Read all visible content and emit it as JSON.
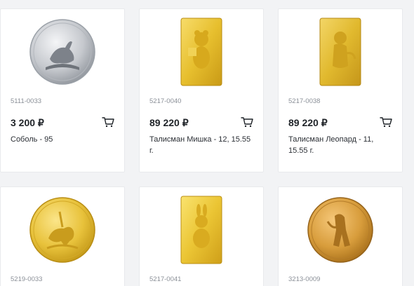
{
  "products": [
    {
      "sku": "5111-0033",
      "price": "3 200 ₽",
      "name": "Соболь - 95",
      "image": "silver-coin-sable"
    },
    {
      "sku": "5217-0040",
      "price": "89 220 ₽",
      "name": "Талисман Мишка - 12, 15.55 г.",
      "image": "gold-bar-bear"
    },
    {
      "sku": "5217-0038",
      "price": "89 220 ₽",
      "name": "Талисман Леопард - 11, 15.55 г.",
      "image": "gold-bar-leopard"
    },
    {
      "sku": "5219-0033",
      "price": "",
      "name": "",
      "image": "gold-coin-george"
    },
    {
      "sku": "5217-0041",
      "price": "",
      "name": "",
      "image": "gold-bar-hare"
    },
    {
      "sku": "3213-0009",
      "price": "",
      "name": "",
      "image": "gold-coin-chervonets"
    }
  ],
  "colors": {
    "accent": "#1f2328",
    "sku": "#8a8f97",
    "gold": "#e9c33a",
    "silver": "#c9ccd1"
  }
}
